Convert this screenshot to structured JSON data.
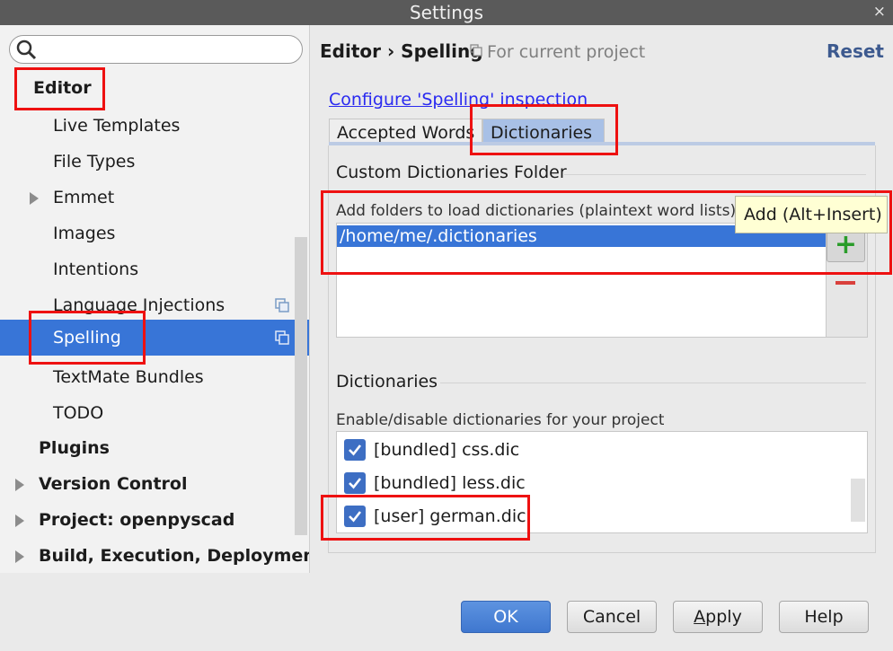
{
  "window": {
    "title": "Settings",
    "close_glyph": "×"
  },
  "search": {
    "placeholder": "",
    "icon": "search-icon"
  },
  "tree": {
    "partial_label": "Editor",
    "items": [
      {
        "label": "Live Templates"
      },
      {
        "label": "File Types"
      },
      {
        "label": "Emmet"
      },
      {
        "label": "Images"
      },
      {
        "label": "Intentions"
      },
      {
        "label": "Language Injections"
      },
      {
        "label": "Spelling"
      },
      {
        "label": "TextMate Bundles"
      },
      {
        "label": "TODO"
      },
      {
        "label": "Plugins"
      },
      {
        "label": "Version Control"
      },
      {
        "label": "Project: openpyscad"
      },
      {
        "label": "Build, Execution, Deploymen"
      }
    ]
  },
  "header": {
    "breadcrumb": "Editor › Spelling",
    "scope": "For current project",
    "reset": "Reset"
  },
  "configure_link": "Configure 'Spelling' inspection",
  "tabs": [
    {
      "label": "Accepted Words"
    },
    {
      "label": "Dictionaries"
    }
  ],
  "custom_folder": {
    "title": "Custom Dictionaries Folder",
    "description": "Add folders to load dictionaries (plaintext word lists) f",
    "items": [
      "/home/me/.dictionaries"
    ],
    "tooltip": "Add (Alt+Insert)",
    "add_glyph": "+"
  },
  "dictionaries": {
    "title": "Dictionaries",
    "description": "Enable/disable dictionaries for your project",
    "items": [
      {
        "label": "[bundled] css.dic",
        "checked": true
      },
      {
        "label": "[bundled] less.dic",
        "checked": true
      },
      {
        "label": "[user] german.dic",
        "checked": true
      }
    ]
  },
  "buttons": {
    "ok": "OK",
    "cancel": "Cancel",
    "apply_mnemonic": "A",
    "apply_rest": "pply",
    "help": "Help"
  },
  "colors": {
    "selection": "#3875d7",
    "annotation": "#ee1111",
    "link": "#2a2af0"
  }
}
